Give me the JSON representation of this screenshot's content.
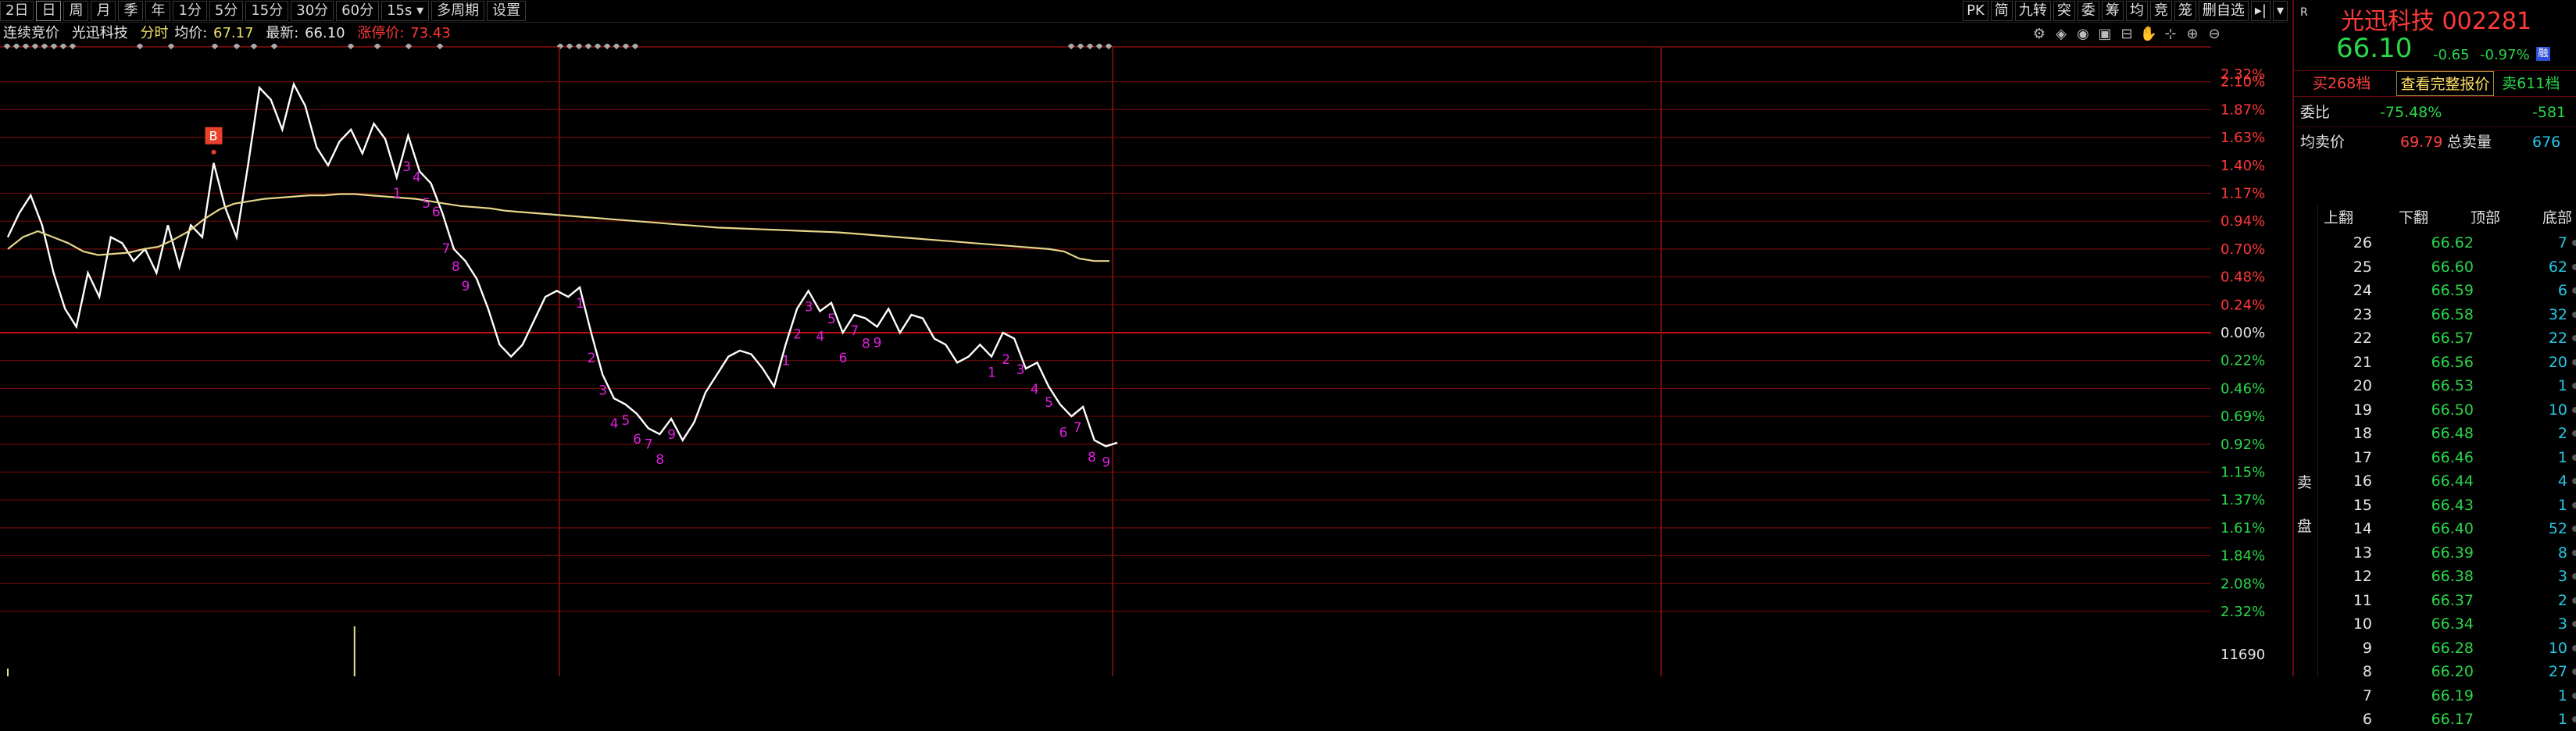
{
  "toolbar": {
    "buttons": [
      "2日",
      "日",
      "周",
      "月",
      "季",
      "年",
      "1分",
      "5分",
      "15分",
      "30分",
      "60分",
      "15s ▾",
      "多周期",
      "设置"
    ],
    "right_buttons": [
      "PK",
      "简",
      "九转",
      "突",
      "委",
      "筹",
      "均",
      "竞",
      "笼",
      "删自选",
      "▸|",
      "▾"
    ]
  },
  "info": {
    "mode": "连续竞价",
    "stock": "光迅科技",
    "view": "分时",
    "avg_label": "均价:",
    "avg_value": "67.17",
    "last_label": "最新:",
    "last_value": "66.10",
    "limit_label": "涨停价:",
    "limit_value": "73.43"
  },
  "chart_data": {
    "type": "line",
    "title": "",
    "xlabel": "",
    "ylabel": "",
    "y_axis_labels": [
      "2.10%",
      "1.87%",
      "1.63%",
      "1.40%",
      "1.17%",
      "0.94%",
      "0.70%",
      "0.48%",
      "0.24%",
      "0.00%",
      "0.22%",
      "0.46%",
      "0.69%",
      "0.92%",
      "1.15%",
      "1.37%",
      "1.61%",
      "1.84%",
      "2.08%",
      "2.32%"
    ],
    "top_label": "2.32%",
    "volume_label": "11690",
    "ylim_pct": [
      -2.32,
      2.32
    ],
    "series": [
      {
        "role": "price",
        "color": "#ffffff",
        "values_pct": [
          0.8,
          1.0,
          1.15,
          0.9,
          0.5,
          0.2,
          0.05,
          0.5,
          0.3,
          0.8,
          0.75,
          0.6,
          0.7,
          0.5,
          0.9,
          0.55,
          0.9,
          0.8,
          1.42,
          1.05,
          0.8,
          1.4,
          2.05,
          1.95,
          1.7,
          2.08,
          1.9,
          1.55,
          1.4,
          1.6,
          1.7,
          1.5,
          1.75,
          1.62,
          1.3,
          1.65,
          1.35,
          1.25,
          1.0,
          0.7,
          0.6,
          0.45,
          0.2,
          -0.1,
          -0.2,
          -0.1,
          0.1,
          0.3,
          0.35,
          0.3,
          0.38,
          0.0,
          -0.35,
          -0.55,
          -0.6,
          -0.68,
          -0.8,
          -0.85,
          -0.72,
          -0.9,
          -0.75,
          -0.5,
          -0.35,
          -0.2,
          -0.15,
          -0.18,
          -0.3,
          -0.45,
          -0.1,
          0.2,
          0.35,
          0.18,
          0.25,
          0.0,
          0.15,
          0.12,
          0.05,
          0.2,
          0.0,
          0.15,
          0.12,
          -0.05,
          -0.1,
          -0.25,
          -0.2,
          -0.1,
          -0.2,
          0.0,
          -0.05,
          -0.3,
          -0.25,
          -0.45,
          -0.6,
          -0.7,
          -0.62,
          -0.9,
          -0.95,
          -0.92
        ]
      },
      {
        "role": "average",
        "color": "#e6d68a",
        "values_pct": [
          0.7,
          0.8,
          0.85,
          0.8,
          0.75,
          0.68,
          0.65,
          0.66,
          0.67,
          0.7,
          0.72,
          0.78,
          0.85,
          0.95,
          1.03,
          1.08,
          1.1,
          1.12,
          1.13,
          1.14,
          1.15,
          1.15,
          1.16,
          1.16,
          1.15,
          1.14,
          1.13,
          1.12,
          1.1,
          1.08,
          1.06,
          1.05,
          1.04,
          1.02,
          1.01,
          1.0,
          0.99,
          0.98,
          0.97,
          0.96,
          0.95,
          0.94,
          0.93,
          0.92,
          0.91,
          0.9,
          0.89,
          0.88,
          0.875,
          0.87,
          0.865,
          0.86,
          0.855,
          0.85,
          0.845,
          0.84,
          0.83,
          0.82,
          0.81,
          0.8,
          0.79,
          0.78,
          0.77,
          0.76,
          0.75,
          0.74,
          0.73,
          0.72,
          0.71,
          0.7,
          0.68,
          0.62,
          0.6,
          0.6
        ]
      }
    ],
    "td_marks": [
      "1",
      "3",
      "4",
      "5",
      "6",
      "7",
      "8",
      "9",
      "1",
      "2",
      "3",
      "4",
      "5",
      "6",
      "7",
      "8",
      "9",
      "1",
      "2",
      "3",
      "4",
      "5",
      "6",
      "7",
      "8",
      "9",
      "1",
      "2",
      "3",
      "4",
      "5",
      "6",
      "7",
      "8",
      "9"
    ],
    "buy_marker": "B",
    "volume_bars": [
      {
        "index": 0,
        "value": 0.1
      },
      {
        "index": 21,
        "value": 1.0
      }
    ]
  },
  "panel": {
    "marker": "R",
    "name": "光迅科技 002281",
    "price": "66.10",
    "change": "-0.65",
    "change_pct": "-0.97%",
    "badge": "融",
    "buy_label": "买268档",
    "full_quote_label": "查看完整报价",
    "sell_label": "卖611档",
    "ratio_label": "委比",
    "ratio_value": "-75.48%",
    "ratio_diff": "-581",
    "avg_sell_label": "均卖价",
    "avg_sell_value": "69.79",
    "total_sell_label": "总卖量",
    "total_sell_value": "676",
    "col_heads": [
      "上翻",
      "下翻",
      "顶部",
      "底部"
    ],
    "side_label": "卖盘",
    "book": [
      {
        "level": "26",
        "price": "66.62",
        "vol": "7"
      },
      {
        "level": "25",
        "price": "66.60",
        "vol": "62"
      },
      {
        "level": "24",
        "price": "66.59",
        "vol": "6"
      },
      {
        "level": "23",
        "price": "66.58",
        "vol": "32"
      },
      {
        "level": "22",
        "price": "66.57",
        "vol": "22"
      },
      {
        "level": "21",
        "price": "66.56",
        "vol": "20"
      },
      {
        "level": "20",
        "price": "66.53",
        "vol": "1"
      },
      {
        "level": "19",
        "price": "66.50",
        "vol": "10"
      },
      {
        "level": "18",
        "price": "66.48",
        "vol": "2"
      },
      {
        "level": "17",
        "price": "66.46",
        "vol": "1"
      },
      {
        "level": "16",
        "price": "66.44",
        "vol": "4"
      },
      {
        "level": "15",
        "price": "66.43",
        "vol": "1"
      },
      {
        "level": "14",
        "price": "66.40",
        "vol": "52"
      },
      {
        "level": "13",
        "price": "66.39",
        "vol": "8"
      },
      {
        "level": "12",
        "price": "66.38",
        "vol": "3"
      },
      {
        "level": "11",
        "price": "66.37",
        "vol": "2"
      },
      {
        "level": "10",
        "price": "66.34",
        "vol": "3"
      },
      {
        "level": "9",
        "price": "66.28",
        "vol": "10"
      },
      {
        "level": "8",
        "price": "66.20",
        "vol": "27"
      },
      {
        "level": "7",
        "price": "66.19",
        "vol": "1"
      },
      {
        "level": "6",
        "price": "66.17",
        "vol": "1"
      }
    ]
  }
}
